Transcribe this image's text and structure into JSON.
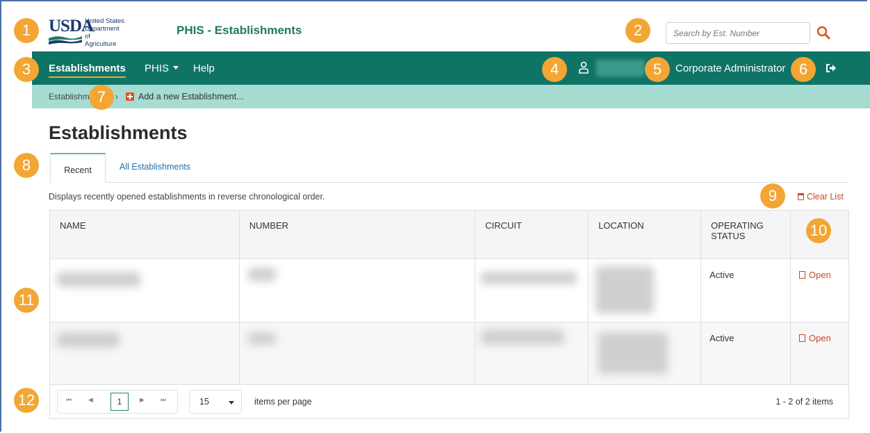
{
  "header": {
    "logo": {
      "wordmark": "USDA",
      "line1": "United States",
      "line2": "Department of",
      "line3": "Agriculture"
    },
    "app_title": "PHIS - Establishments",
    "search_placeholder": "Search by Est. Number"
  },
  "nav": {
    "items": [
      "Establishments",
      "PHIS",
      "Help"
    ],
    "role": "Corporate Administrator"
  },
  "breadcrumb": {
    "current": "Establishments",
    "separator": "›",
    "add_link": "Add a new Establishment..."
  },
  "main": {
    "title": "Establishments",
    "tabs": [
      "Recent",
      "All Establishments"
    ],
    "active_tab": "Recent",
    "description": "Displays recently opened establishments in reverse chronological order.",
    "clear_list": "Clear List"
  },
  "table": {
    "columns": [
      "NAME",
      "NUMBER",
      "CIRCUIT",
      "LOCATION",
      "OPERATING STATUS",
      ""
    ],
    "rows": [
      {
        "status": "Active",
        "action": "Open"
      },
      {
        "status": "Active",
        "action": "Open"
      }
    ]
  },
  "pager": {
    "current_page": "1",
    "page_size": "15",
    "per_page_label": "items per page",
    "info": "1 - 2 of 2 items"
  },
  "callouts": [
    "1",
    "2",
    "3",
    "4",
    "5",
    "6",
    "7",
    "8",
    "9",
    "10",
    "11",
    "12"
  ],
  "colors": {
    "nav": "#0f7466",
    "breadcrumb": "#a7dcd2",
    "accent": "#f3a634",
    "title": "#1e7a5e",
    "action": "#c24a2a"
  }
}
